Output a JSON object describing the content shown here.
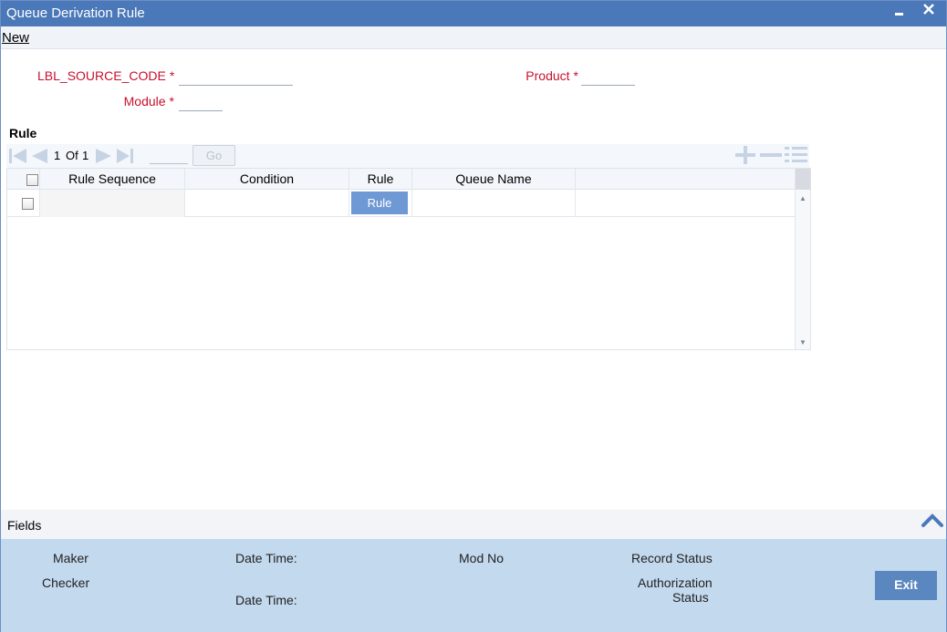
{
  "window": {
    "title": "Queue Derivation Rule",
    "minimize_icon": "minimize-icon",
    "close_icon": "close-icon"
  },
  "menu": {
    "new_label": "New"
  },
  "form": {
    "source_code_label": "LBL_SOURCE_CODE",
    "module_label": "Module",
    "product_label": "Product",
    "required_mark": "*",
    "source_code_value": "",
    "module_value": "",
    "product_value": ""
  },
  "rule_section": {
    "title": "Rule",
    "pager": {
      "current": "1",
      "of_label": "Of",
      "total": "1",
      "go_label": "Go",
      "page_input": ""
    },
    "columns": [
      "Rule Sequence",
      "Condition",
      "Rule",
      "Queue Name"
    ],
    "rows": [
      {
        "rule_sequence": "",
        "condition": "",
        "rule_button": "Rule",
        "queue_name": ""
      }
    ]
  },
  "fields_bar": {
    "label": "Fields"
  },
  "footer": {
    "maker": "Maker",
    "checker": "Checker",
    "date_time_1": "Date Time:",
    "date_time_2": "Date Time:",
    "mod_no": "Mod No",
    "record_status": "Record Status",
    "authorization_status_line1": "Authorization",
    "authorization_status_line2": "Status",
    "exit_label": "Exit"
  },
  "colors": {
    "titlebar": "#4a78b8",
    "required_label": "#c8102e",
    "footer_bg": "#c3d9ee",
    "button_blue": "#5a87c0"
  }
}
